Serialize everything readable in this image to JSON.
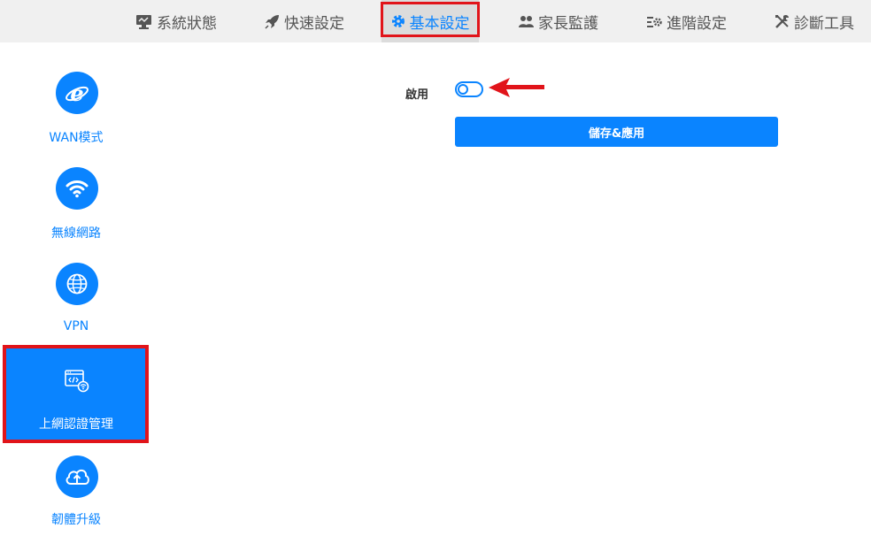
{
  "nav": {
    "tabs": [
      {
        "label": "系統狀態",
        "icon": "monitor-icon"
      },
      {
        "label": "快速設定",
        "icon": "rocket-icon"
      },
      {
        "label": "基本設定",
        "icon": "gear-icon",
        "active": true
      },
      {
        "label": "家長監護",
        "icon": "users-icon"
      },
      {
        "label": "進階設定",
        "icon": "advanced-settings-icon"
      },
      {
        "label": "診斷工具",
        "icon": "tools-icon"
      }
    ]
  },
  "sidebar": {
    "items": [
      {
        "label": "WAN模式",
        "icon": "internet-explorer-icon"
      },
      {
        "label": "無線網路",
        "icon": "wifi-icon"
      },
      {
        "label": "VPN",
        "icon": "globe-icon"
      },
      {
        "label": "上網認證管理",
        "icon": "web-auth-icon",
        "active": true
      },
      {
        "label": "韌體升級",
        "icon": "cloud-upload-icon"
      }
    ]
  },
  "main": {
    "enable_label": "啟用",
    "enable_toggle_on": false,
    "save_button": "儲存&應用"
  },
  "colors": {
    "accent": "#0a84ff",
    "highlight": "#e1141a",
    "topbar_bg": "#f0f0f0"
  }
}
